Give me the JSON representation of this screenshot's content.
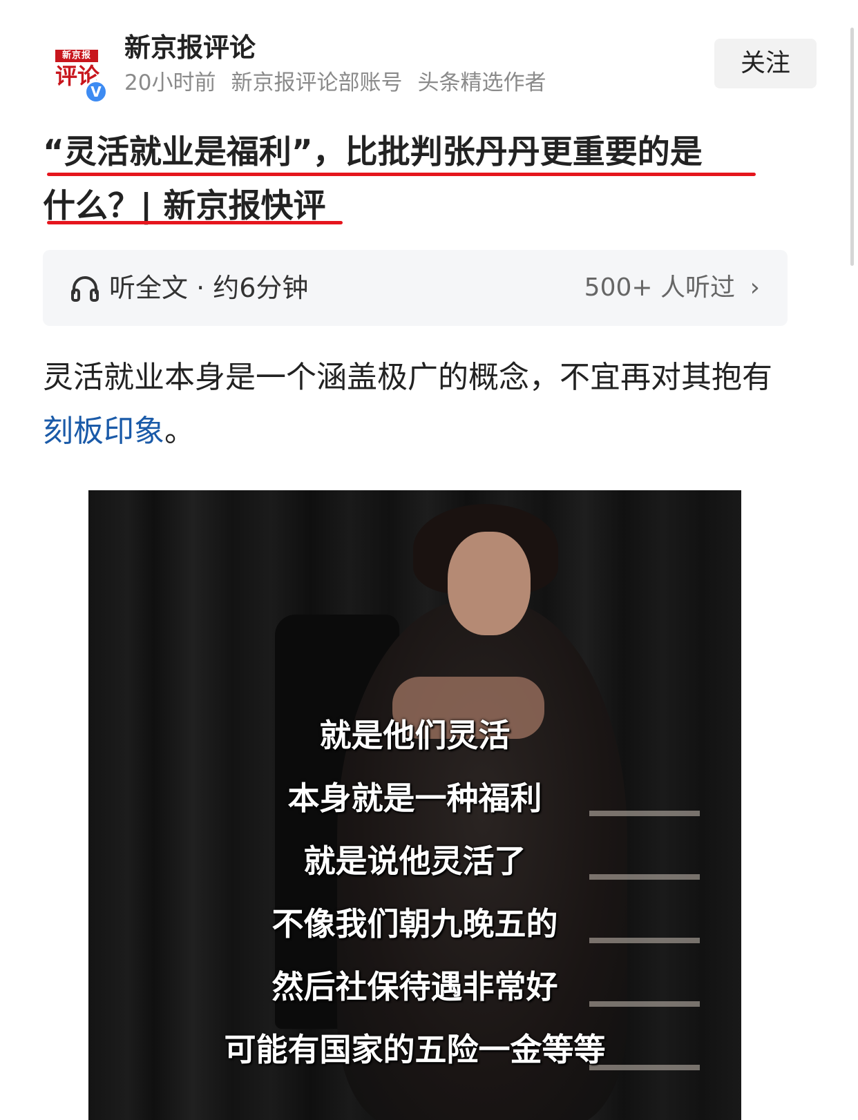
{
  "author": {
    "logo_top": "新京报",
    "logo_bottom": "评论",
    "verified_badge": "V",
    "name": "新京报评论",
    "time": "20小时前",
    "account_desc": "新京报评论部账号",
    "author_tag": "头条精选作者",
    "follow_label": "关注"
  },
  "article": {
    "title_line1": "“灵活就业是福利”，比批判张丹丹更重要的是",
    "title_line2": "什么？| 新京报快评",
    "audio": {
      "icon": "headphone-icon",
      "label": "听全文 · 约6分钟",
      "listen_count": "500+ 人听过",
      "chevron": "›"
    },
    "lead_before": "灵活就业本身是一个涵盖极广的概念，不宜再对其抱有",
    "lead_link": "刻板印象",
    "lead_after": "。"
  },
  "video": {
    "subtitles": [
      "就是他们灵活",
      "本身就是一种福利",
      "就是说他灵活了",
      "不像我们朝九晚五的",
      "然后社保待遇非常好",
      "可能有国家的五险一金等等"
    ]
  },
  "colors": {
    "accent_red": "#e5151d",
    "link_blue": "#1a5aa8",
    "verified_blue": "#3d8bf2"
  }
}
